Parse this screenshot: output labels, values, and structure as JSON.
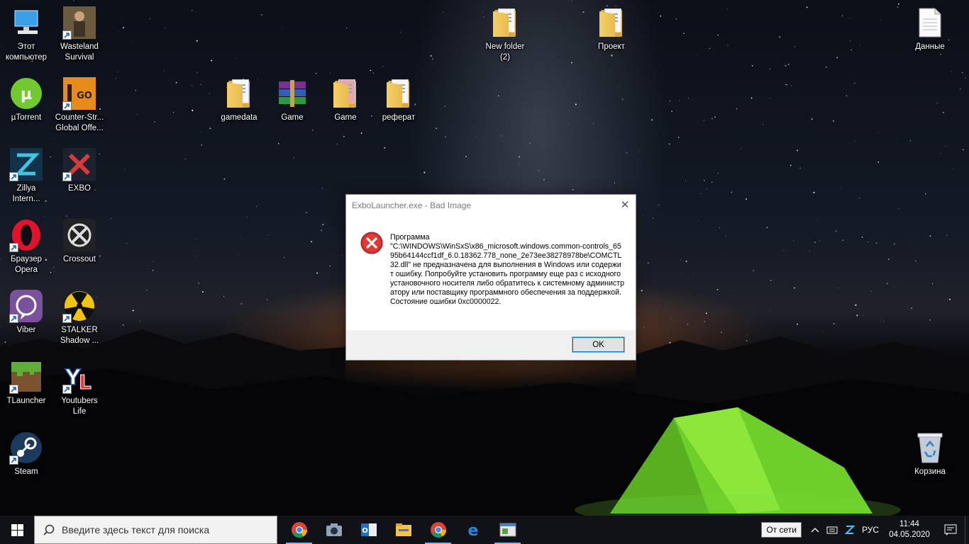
{
  "desktop": {
    "icons": [
      {
        "label": "Этот\nкомпьютер",
        "icon": "computer-icon"
      },
      {
        "label": "Wasteland\nSurvival",
        "icon": "wasteland-icon"
      },
      {
        "label": "µTorrent",
        "icon": "utorrent-icon"
      },
      {
        "label": "Counter-Str...\nGlobal Offe...",
        "icon": "csgo-icon"
      },
      {
        "label": "Zillya\nIntern...",
        "icon": "zillya-icon"
      },
      {
        "label": "EXBO",
        "icon": "exbo-icon"
      },
      {
        "label": "Браузер\nOpera",
        "icon": "opera-icon"
      },
      {
        "label": "Crossout",
        "icon": "crossout-icon"
      },
      {
        "label": "Viber",
        "icon": "viber-icon"
      },
      {
        "label": "STALKER\nShadow ...",
        "icon": "stalker-icon"
      },
      {
        "label": "TLauncher",
        "icon": "minecraft-icon"
      },
      {
        "label": "Youtubers\nLife",
        "icon": "youtubers-life-icon"
      },
      {
        "label": "Steam",
        "icon": "steam-icon"
      },
      {
        "label": "gamedata",
        "icon": "folder-icon"
      },
      {
        "label": "Game",
        "icon": "winrar-icon"
      },
      {
        "label": "Game",
        "icon": "folder-icon"
      },
      {
        "label": "реферат",
        "icon": "folder-icon"
      },
      {
        "label": "New folder\n(2)",
        "icon": "folder-icon"
      },
      {
        "label": "Проект",
        "icon": "folder-icon"
      },
      {
        "label": "Данные",
        "icon": "document-icon"
      },
      {
        "label": "Корзина",
        "icon": "recycle-bin-icon"
      }
    ]
  },
  "dialog": {
    "title": "ExboLauncher.exe - Bad Image",
    "message": "Программа\n\"C:\\WINDOWS\\WinSxS\\x86_microsoft.windows.common-controls_6595b64144ccf1df_6.0.18362.778_none_2e73ee38278978be\\COMCTL32.dll\" не предназначена для выполнения в Windows или содержит ошибку. Попробуйте установить программу еще раз с исходного установочного носителя либо обратитесь к системному администратору или поставщику программного обеспечения за поддержкой. Состояние ошибки 0xc0000022.",
    "ok_label": "OK",
    "close_glyph": "✕"
  },
  "taskbar": {
    "search_placeholder": "Введите здесь текст для поиска",
    "pinned": [
      "chrome-icon",
      "camera-icon",
      "outlook-icon",
      "file-explorer-icon",
      "chrome-icon",
      "edge-icon",
      "app-icon"
    ],
    "tooltip": "От сети",
    "language": "РУС",
    "time": "11:44",
    "date": "04.05.2020"
  },
  "colors": {
    "accent": "#0078d7",
    "error_red": "#d32f2f",
    "taskbar": "#101218"
  }
}
